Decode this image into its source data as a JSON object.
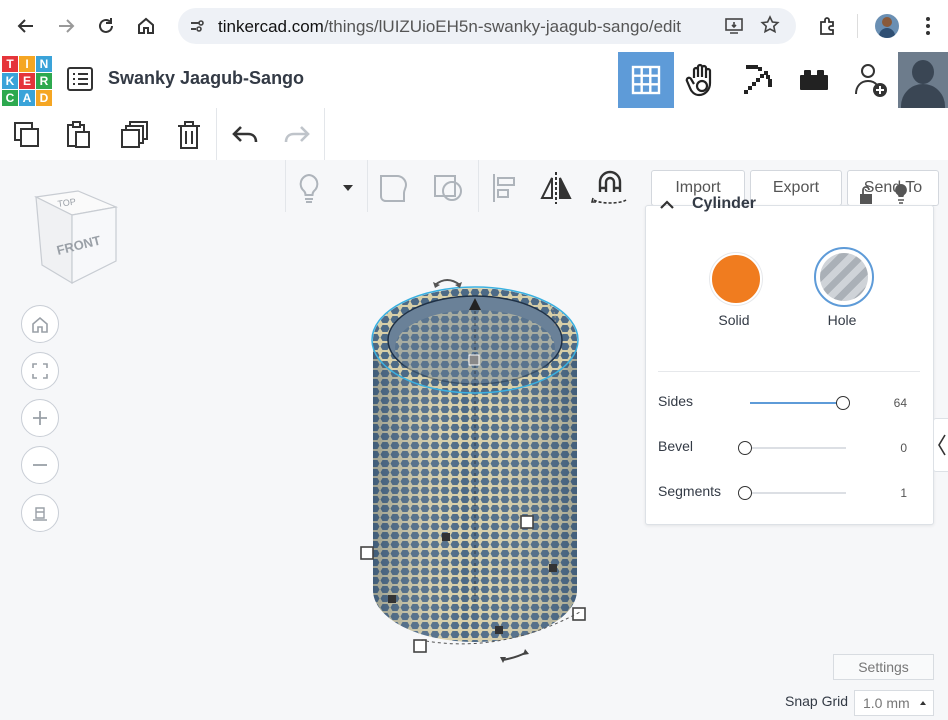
{
  "browser": {
    "url_domain": "tinkercad.com",
    "url_path": "/things/lUIZUioEH5n-swanky-jaagub-sango/edit"
  },
  "app": {
    "logo_letters": [
      "T",
      "I",
      "N",
      "K",
      "E",
      "R",
      "C",
      "A",
      "D"
    ],
    "logo_colors": [
      "#e5343a",
      "#f5a623",
      "#3aa3d9",
      "#3aa3d9",
      "#e5343a",
      "#2da94f",
      "#2da94f",
      "#3aa3d9",
      "#f5a623"
    ],
    "project_title": "Swanky Jaagub-Sango",
    "accent": "#5e9bd8"
  },
  "header_nav": {
    "items": [
      "3d-design-grid-icon",
      "codeblocks-hand-icon",
      "minecraft-pickaxe-icon",
      "lego-brick-icon",
      "add-user-icon",
      "user-avatar"
    ]
  },
  "edit_toolbar": {
    "items": [
      "copy-icon",
      "paste-icon",
      "duplicate-icon",
      "delete-icon",
      "undo-icon",
      "redo-icon"
    ]
  },
  "workplane_tools": {
    "items": [
      "lightbulb-icon",
      "dropdown-caret-icon",
      "group-icon",
      "ungroup-icon",
      "align-icon",
      "mirror-icon",
      "cruise-magnet-icon"
    ]
  },
  "actions": {
    "import": "Import",
    "export": "Export",
    "send_to": "Send To"
  },
  "view_cube": {
    "top": "TOP",
    "front": "FRONT"
  },
  "inspector": {
    "title": "Cylinder",
    "solid_label": "Solid",
    "hole_label": "Hole",
    "solid_color": "#f07c1f",
    "params": [
      {
        "label": "Sides",
        "value": "64",
        "fraction": 1.0
      },
      {
        "label": "Bevel",
        "value": "0",
        "fraction": 0.0
      },
      {
        "label": "Segments",
        "value": "1",
        "fraction": 0.0
      }
    ]
  },
  "footer": {
    "settings": "Settings",
    "snap_grid_label": "Snap Grid",
    "snap_grid_value": "1.0 mm"
  }
}
